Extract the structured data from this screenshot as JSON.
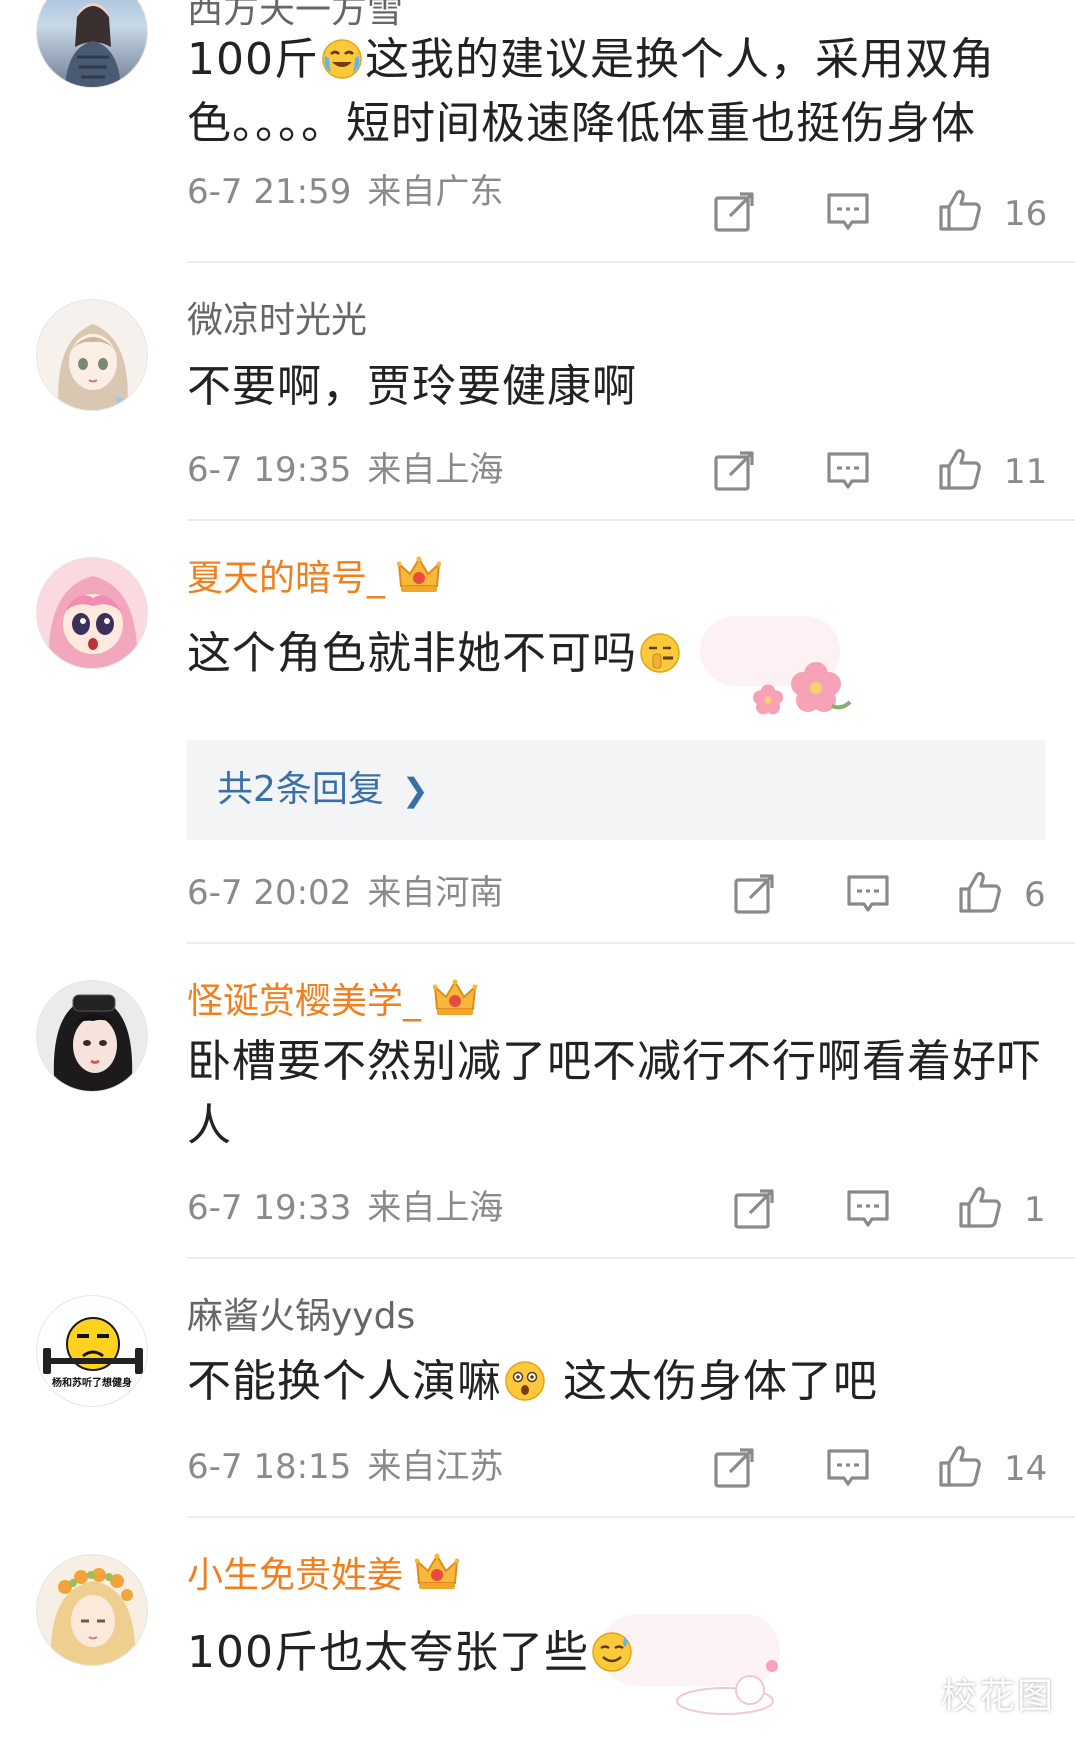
{
  "comments": [
    {
      "username": "西方天一方雪",
      "text_lines": [
        "100斤",
        "这我的建议是换个人，采用双角",
        "色。。。。短时间极速降低体重也挺伤身体"
      ],
      "time": "6-7 21:59",
      "location": "来自广东",
      "likes": "16",
      "vip": false,
      "emoji": "crying-laughing-emoji"
    },
    {
      "username": "微凉时光光",
      "text": "不要啊，贾玲要健康啊",
      "time": "6-7 19:35",
      "location": "来自上海",
      "likes": "11",
      "vip": false
    },
    {
      "username": "夏天的暗号_",
      "text": "这个角色就非她不可吗",
      "time": "6-7 20:02",
      "location": "来自河南",
      "likes": "6",
      "vip": true,
      "emoji": "shush-emoji",
      "replies_label": "共2条回复"
    },
    {
      "username": "怪诞赏樱美学_",
      "text_lines": [
        "卧槽要不然别减了吧不减行不行啊看着好吓",
        "人"
      ],
      "time": "6-7 19:33",
      "location": "来自上海",
      "likes": "1",
      "vip": true
    },
    {
      "username": "麻酱火锅yyds",
      "text_a": "不能换个人演嘛",
      "text_b": " 这太伤身体了吧",
      "time": "6-7 18:15",
      "location": "来自江苏",
      "likes": "14",
      "vip": false,
      "emoji": "shocked-emoji",
      "avatar_text": "杨和苏听了想健身"
    },
    {
      "username": "小生免贵姓姜",
      "text": "100斤也太夸张了些",
      "vip": true,
      "emoji": "sweat-smile-emoji"
    }
  ],
  "watermark": "校花图",
  "colors": {
    "vip_name": "#f07f1e",
    "normal_name": "#666666",
    "replies_link": "#3a6fa8"
  }
}
